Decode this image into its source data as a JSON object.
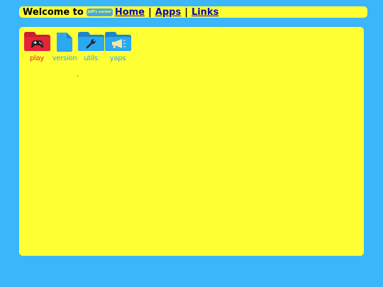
{
  "topbar": {
    "welcome": "Welcome to",
    "logo_text": "jeff's corner",
    "links": [
      "Home",
      "Apps",
      "Links"
    ],
    "separator": "|"
  },
  "desktop": {
    "icons": [
      {
        "label": "play",
        "icon": "gamepad-folder-icon",
        "color": "#e8223a"
      },
      {
        "label": "version",
        "icon": "file-icon",
        "color": "#2aa8f0"
      },
      {
        "label": "utils",
        "icon": "wrench-folder-icon",
        "color": "#2aa8f0"
      },
      {
        "label": "yaps",
        "icon": "megaphone-folder-icon",
        "color": "#2aa8f0"
      }
    ]
  },
  "colors": {
    "background": "#3cb6fb",
    "panel": "#ffff33",
    "link": "#0a0aa8"
  }
}
